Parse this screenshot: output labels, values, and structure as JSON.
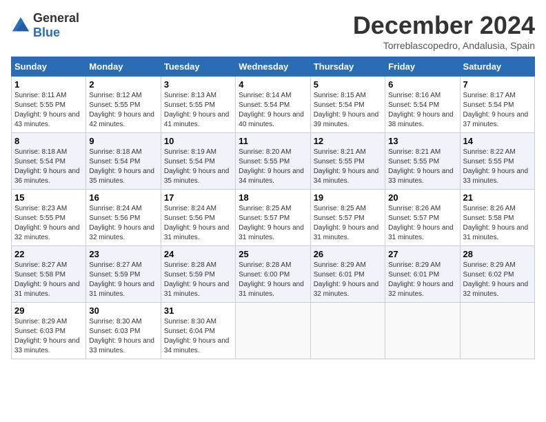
{
  "logo": {
    "general": "General",
    "blue": "Blue"
  },
  "title": "December 2024",
  "subtitle": "Torreblascopedro, Andalusia, Spain",
  "headers": [
    "Sunday",
    "Monday",
    "Tuesday",
    "Wednesday",
    "Thursday",
    "Friday",
    "Saturday"
  ],
  "weeks": [
    [
      {
        "day": "1",
        "sunrise": "8:11 AM",
        "sunset": "5:55 PM",
        "daylight": "9 hours and 43 minutes."
      },
      {
        "day": "2",
        "sunrise": "8:12 AM",
        "sunset": "5:55 PM",
        "daylight": "9 hours and 42 minutes."
      },
      {
        "day": "3",
        "sunrise": "8:13 AM",
        "sunset": "5:55 PM",
        "daylight": "9 hours and 41 minutes."
      },
      {
        "day": "4",
        "sunrise": "8:14 AM",
        "sunset": "5:54 PM",
        "daylight": "9 hours and 40 minutes."
      },
      {
        "day": "5",
        "sunrise": "8:15 AM",
        "sunset": "5:54 PM",
        "daylight": "9 hours and 39 minutes."
      },
      {
        "day": "6",
        "sunrise": "8:16 AM",
        "sunset": "5:54 PM",
        "daylight": "9 hours and 38 minutes."
      },
      {
        "day": "7",
        "sunrise": "8:17 AM",
        "sunset": "5:54 PM",
        "daylight": "9 hours and 37 minutes."
      }
    ],
    [
      {
        "day": "8",
        "sunrise": "8:18 AM",
        "sunset": "5:54 PM",
        "daylight": "9 hours and 36 minutes."
      },
      {
        "day": "9",
        "sunrise": "8:18 AM",
        "sunset": "5:54 PM",
        "daylight": "9 hours and 35 minutes."
      },
      {
        "day": "10",
        "sunrise": "8:19 AM",
        "sunset": "5:54 PM",
        "daylight": "9 hours and 35 minutes."
      },
      {
        "day": "11",
        "sunrise": "8:20 AM",
        "sunset": "5:55 PM",
        "daylight": "9 hours and 34 minutes."
      },
      {
        "day": "12",
        "sunrise": "8:21 AM",
        "sunset": "5:55 PM",
        "daylight": "9 hours and 34 minutes."
      },
      {
        "day": "13",
        "sunrise": "8:21 AM",
        "sunset": "5:55 PM",
        "daylight": "9 hours and 33 minutes."
      },
      {
        "day": "14",
        "sunrise": "8:22 AM",
        "sunset": "5:55 PM",
        "daylight": "9 hours and 33 minutes."
      }
    ],
    [
      {
        "day": "15",
        "sunrise": "8:23 AM",
        "sunset": "5:55 PM",
        "daylight": "9 hours and 32 minutes."
      },
      {
        "day": "16",
        "sunrise": "8:24 AM",
        "sunset": "5:56 PM",
        "daylight": "9 hours and 32 minutes."
      },
      {
        "day": "17",
        "sunrise": "8:24 AM",
        "sunset": "5:56 PM",
        "daylight": "9 hours and 31 minutes."
      },
      {
        "day": "18",
        "sunrise": "8:25 AM",
        "sunset": "5:57 PM",
        "daylight": "9 hours and 31 minutes."
      },
      {
        "day": "19",
        "sunrise": "8:25 AM",
        "sunset": "5:57 PM",
        "daylight": "9 hours and 31 minutes."
      },
      {
        "day": "20",
        "sunrise": "8:26 AM",
        "sunset": "5:57 PM",
        "daylight": "9 hours and 31 minutes."
      },
      {
        "day": "21",
        "sunrise": "8:26 AM",
        "sunset": "5:58 PM",
        "daylight": "9 hours and 31 minutes."
      }
    ],
    [
      {
        "day": "22",
        "sunrise": "8:27 AM",
        "sunset": "5:58 PM",
        "daylight": "9 hours and 31 minutes."
      },
      {
        "day": "23",
        "sunrise": "8:27 AM",
        "sunset": "5:59 PM",
        "daylight": "9 hours and 31 minutes."
      },
      {
        "day": "24",
        "sunrise": "8:28 AM",
        "sunset": "5:59 PM",
        "daylight": "9 hours and 31 minutes."
      },
      {
        "day": "25",
        "sunrise": "8:28 AM",
        "sunset": "6:00 PM",
        "daylight": "9 hours and 31 minutes."
      },
      {
        "day": "26",
        "sunrise": "8:29 AM",
        "sunset": "6:01 PM",
        "daylight": "9 hours and 32 minutes."
      },
      {
        "day": "27",
        "sunrise": "8:29 AM",
        "sunset": "6:01 PM",
        "daylight": "9 hours and 32 minutes."
      },
      {
        "day": "28",
        "sunrise": "8:29 AM",
        "sunset": "6:02 PM",
        "daylight": "9 hours and 32 minutes."
      }
    ],
    [
      {
        "day": "29",
        "sunrise": "8:29 AM",
        "sunset": "6:03 PM",
        "daylight": "9 hours and 33 minutes."
      },
      {
        "day": "30",
        "sunrise": "8:30 AM",
        "sunset": "6:03 PM",
        "daylight": "9 hours and 33 minutes."
      },
      {
        "day": "31",
        "sunrise": "8:30 AM",
        "sunset": "6:04 PM",
        "daylight": "9 hours and 34 minutes."
      },
      null,
      null,
      null,
      null
    ]
  ],
  "labels": {
    "sunrise": "Sunrise:",
    "sunset": "Sunset:",
    "daylight": "Daylight:"
  }
}
